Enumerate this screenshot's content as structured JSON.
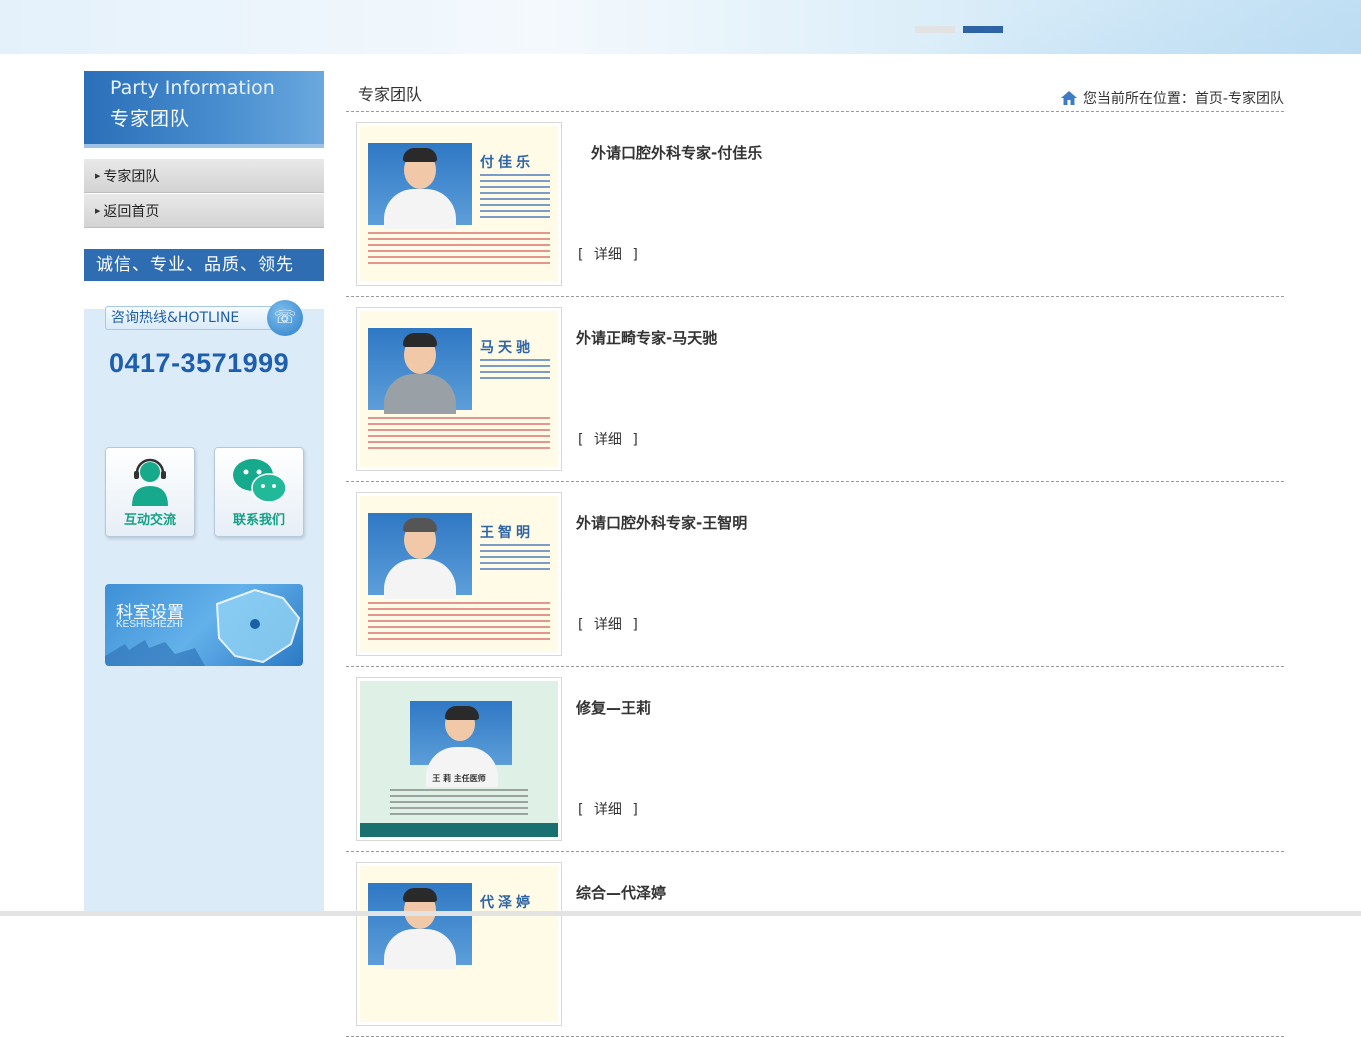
{
  "banner": {
    "slides": 2,
    "active_slide": 2
  },
  "sidebar": {
    "header_en": "Party Information",
    "header_cn": "专家团队",
    "nav": [
      {
        "label": "专家团队"
      },
      {
        "label": "返回首页"
      }
    ],
    "slogan": "诚信、专业、品质、领先",
    "hotline_label": "咨询热线&HOTLINE",
    "hotline_number": "0417-3571999",
    "tiles": [
      {
        "label": "互动交流",
        "icon": "customer-service-icon"
      },
      {
        "label": "联系我们",
        "icon": "wechat-icon"
      }
    ],
    "department": {
      "cn": "科室设置",
      "en": "KESHISHEZHI"
    }
  },
  "main": {
    "title": "专家团队",
    "breadcrumb": "您当前所在位置：首页-专家团队",
    "more_label": "[  详细  ]",
    "items": [
      {
        "title": "外请口腔外科专家-付佳乐",
        "card_name": "付佳乐"
      },
      {
        "title": "外请正畸专家-马天驰",
        "card_name": "马天驰"
      },
      {
        "title": "外请口腔外科专家-王智明",
        "card_name": "王智明"
      },
      {
        "title": "修复—王莉",
        "card_name": "王  莉  主任医师"
      },
      {
        "title": "综合—代泽婷",
        "card_name": "代泽婷"
      }
    ]
  },
  "colors": {
    "accent": "#2f6db2",
    "sidebar_bg": "#dcebf8",
    "tile_text": "#15a085"
  }
}
